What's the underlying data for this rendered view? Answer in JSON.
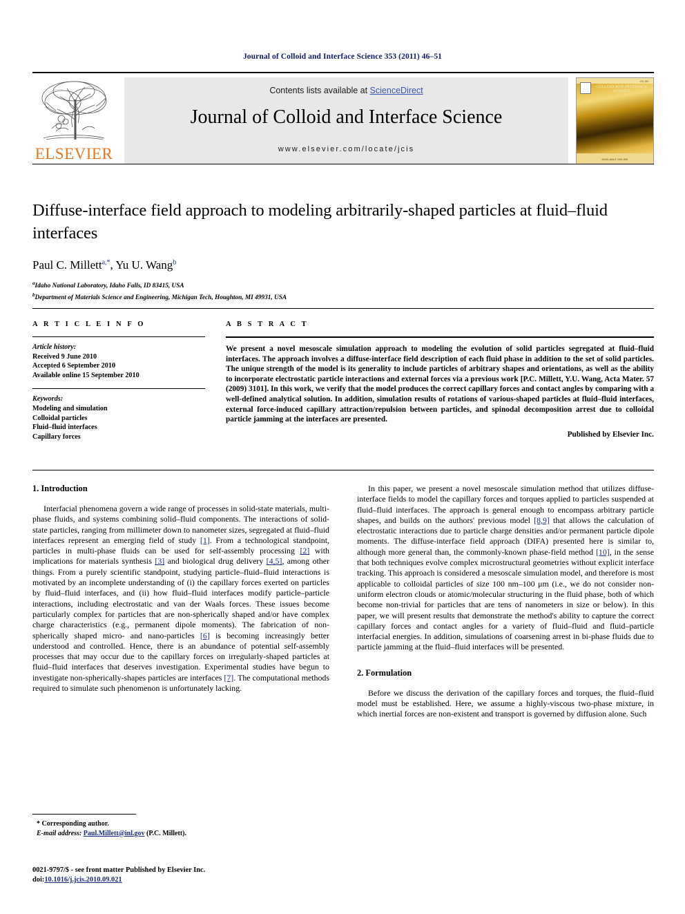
{
  "running_head": "Journal of Colloid and Interface Science 353 (2011) 46–51",
  "masthead": {
    "contents_prefix": "Contents lists available at ",
    "sciencedirect": "ScienceDirect",
    "journal_title": "Journal of Colloid and Interface Science",
    "journal_url": "www.elsevier.com/locate/jcis",
    "publisher_wordmark": "ELSEVIER",
    "cover": {
      "title_lines": "COLLOID AND INTERFACE SCIENCE",
      "kicker": "Journal of",
      "footer": "AVAILABLE ONLINE",
      "volume_note": "VOL 353"
    },
    "accent_orange": "#e8761b",
    "link_blue": "#3a55b4"
  },
  "article": {
    "title": "Diffuse-interface field approach to modeling arbitrarily-shaped particles at fluid–fluid interfaces",
    "authors_part1": "Paul C. Millett",
    "authors_sup1": "a,*",
    "authors_part2": ", Yu U. Wang",
    "authors_sup2": "b",
    "affiliation_a_sup": "a",
    "affiliation_a": "Idaho National Laboratory, Idaho Falls, ID 83415, USA",
    "affiliation_b_sup": "b",
    "affiliation_b": "Department of Materials Science and Engineering, Michigan Tech, Houghton, MI 49931, USA"
  },
  "info": {
    "heading": "A R T I C L E    I N F O",
    "history_label": "Article history:",
    "history": [
      "Received 9 June 2010",
      "Accepted 6 September 2010",
      "Available online 15 September 2010"
    ],
    "keywords_label": "Keywords:",
    "keywords": [
      "Modeling and simulation",
      "Colloidal particles",
      "Fluid–fluid interfaces",
      "Capillary forces"
    ]
  },
  "abstract": {
    "heading": "A B S T R A C T",
    "text": "We present a novel mesoscale simulation approach to modeling the evolution of solid particles segregated at fluid–fluid interfaces. The approach involves a diffuse-interface field description of each fluid phase in addition to the set of solid particles. The unique strength of the model is its generality to include particles of arbitrary shapes and orientations, as well as the ability to incorporate electrostatic particle interactions and external forces via a previous work [P.C. Millett, Y.U. Wang, Acta Mater. 57 (2009) 3101]. In this work, we verify that the model produces the correct capillary forces and contact angles by comparing with a well-defined analytical solution. In addition, simulation results of rotations of various-shaped particles at fluid–fluid interfaces, external force-induced capillary attraction/repulsion between particles, and spinodal decomposition arrest due to colloidal particle jamming at the interfaces are presented.",
    "published_by": "Published by Elsevier Inc."
  },
  "sections": {
    "introduction_heading": "1. Introduction",
    "intro_p1_a": "Interfacial phenomena govern a wide range of processes in solid-state materials, multi-phase fluids, and systems combining solid–fluid components. The interactions of solid-state particles, ranging from millimeter down to nanometer sizes, segregated at fluid–fluid interfaces represent an emerging field of study ",
    "intro_ref1": "[1]",
    "intro_p1_b": ". From a technological standpoint, particles in multi-phase fluids can be used for self-assembly processing ",
    "intro_ref2": "[2]",
    "intro_p1_c": " with implications for materials synthesis ",
    "intro_ref3": "[3]",
    "intro_p1_d": " and biological drug delivery ",
    "intro_ref45": "[4,5]",
    "intro_p1_e": ", among other things. From a purely scientific standpoint, studying particle–fluid–fluid interactions is motivated by an incomplete understanding of (i) the capillary forces exerted on particles by fluid–fluid interfaces, and (ii) how fluid–fluid interfaces modify particle–particle interactions, including electrostatic and van der Waals forces. These issues become particularly complex for particles that are non-spherically shaped and/or have complex charge characteristics (e.g., permanent dipole moments). The fabrication of non-spherically shaped micro- and nano-particles ",
    "intro_ref6": "[6]",
    "intro_p1_f": " is becoming increasingly better understood and controlled. Hence, there is an abundance of potential self-assembly processes that may occur due to the capillary forces on irregularly-shaped particles at fluid–fluid interfaces that deserves investigation. Experimental studies have begun to investigate non-spherically-shapes particles are interfaces ",
    "intro_ref7": "[7]",
    "intro_p1_g": ". The computational methods required to simulate such phenomenon is unfortunately lacking.",
    "right_p1_a": "In this paper, we present a novel mesoscale simulation method that utilizes diffuse-interface fields to model the capillary forces and torques applied to particles suspended at fluid–fluid interfaces. The approach is general enough to encompass arbitrary particle shapes, and builds on the authors' previous model ",
    "right_ref89": "[8,9]",
    "right_p1_b": " that allows the calculation of electrostatic interactions due to particle charge densities and/or permanent particle dipole moments. The diffuse-interface field approach (DIFA) presented here is similar to, although more general than, the commonly-known phase-field method ",
    "right_ref10": "[10]",
    "right_p1_c": ", in the sense that both techniques evolve complex microstructural geometries without explicit interface tracking. This approach is considered a mesoscale simulation model, and therefore is most applicable to colloidal particles of size 100 nm–100 μm (i.e., we do not consider non-uniform electron clouds or atomic/molecular structuring in the fluid phase, both of which become non-trivial for particles that are tens of nanometers in size or below). In this paper, we will present results that demonstrate the method's ability to capture the correct capillary forces and contact angles for a variety of fluid–fluid and fluid–particle interfacial energies. In addition, simulations of coarsening arrest in bi-phase fluids due to particle jamming at the fluid–fluid interfaces will be presented.",
    "formulation_heading": "2. Formulation",
    "formulation_p1": "Before we discuss the derivation of the capillary forces and torques, the fluid–fluid model must be established. Here, we assume a highly-viscous two-phase mixture, in which inertial forces are non-existent and transport is governed by diffusion alone. Such"
  },
  "footnotes": {
    "corresponding_marker": "*",
    "corresponding_text": "Corresponding author.",
    "email_label": "E-mail address:",
    "email": "Paul.Millett@inl.gov",
    "email_suffix": "(P.C. Millett)."
  },
  "imprint": {
    "line1": "0021-9797/$ - see front matter Published by Elsevier Inc.",
    "doi_label": "doi:",
    "doi_value": "10.1016/j.jcis.2010.09.021"
  }
}
